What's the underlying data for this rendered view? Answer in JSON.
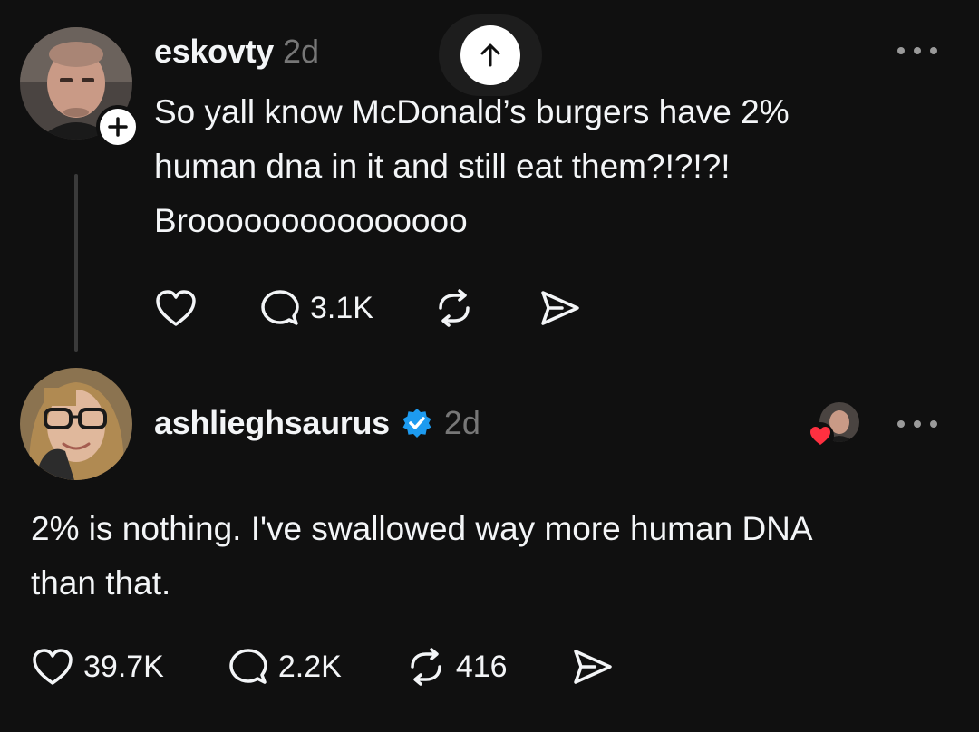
{
  "posts": [
    {
      "username": "eskovty",
      "timestamp": "2d",
      "avatar_icon": "profile-photo-icon",
      "follow_icon": "plus-icon",
      "text": "So yall know McDonald’s burgers have 2%\nhuman dna in it and still eat them?!?!?!\nBrooooooooooooooo",
      "stats": {
        "likes": "",
        "replies": "3.1K",
        "reposts": "",
        "shares": ""
      }
    },
    {
      "username": "ashlieghsaurus",
      "timestamp": "2d",
      "verified": true,
      "verified_color": "#1d9bf0",
      "avatar_icon": "profile-photo-icon",
      "liked_by_author_icon": "heart-icon",
      "text": "2% is nothing. I've swallowed way more human DNA\nthan that.",
      "stats": {
        "likes": "39.7K",
        "replies": "2.2K",
        "reposts": "416",
        "shares": ""
      }
    }
  ],
  "scroll_top_icon": "arrow-up-icon",
  "colors": {
    "background": "#101010",
    "text": "#f3f5f7",
    "muted": "#777777",
    "heart": "#ff3040"
  }
}
